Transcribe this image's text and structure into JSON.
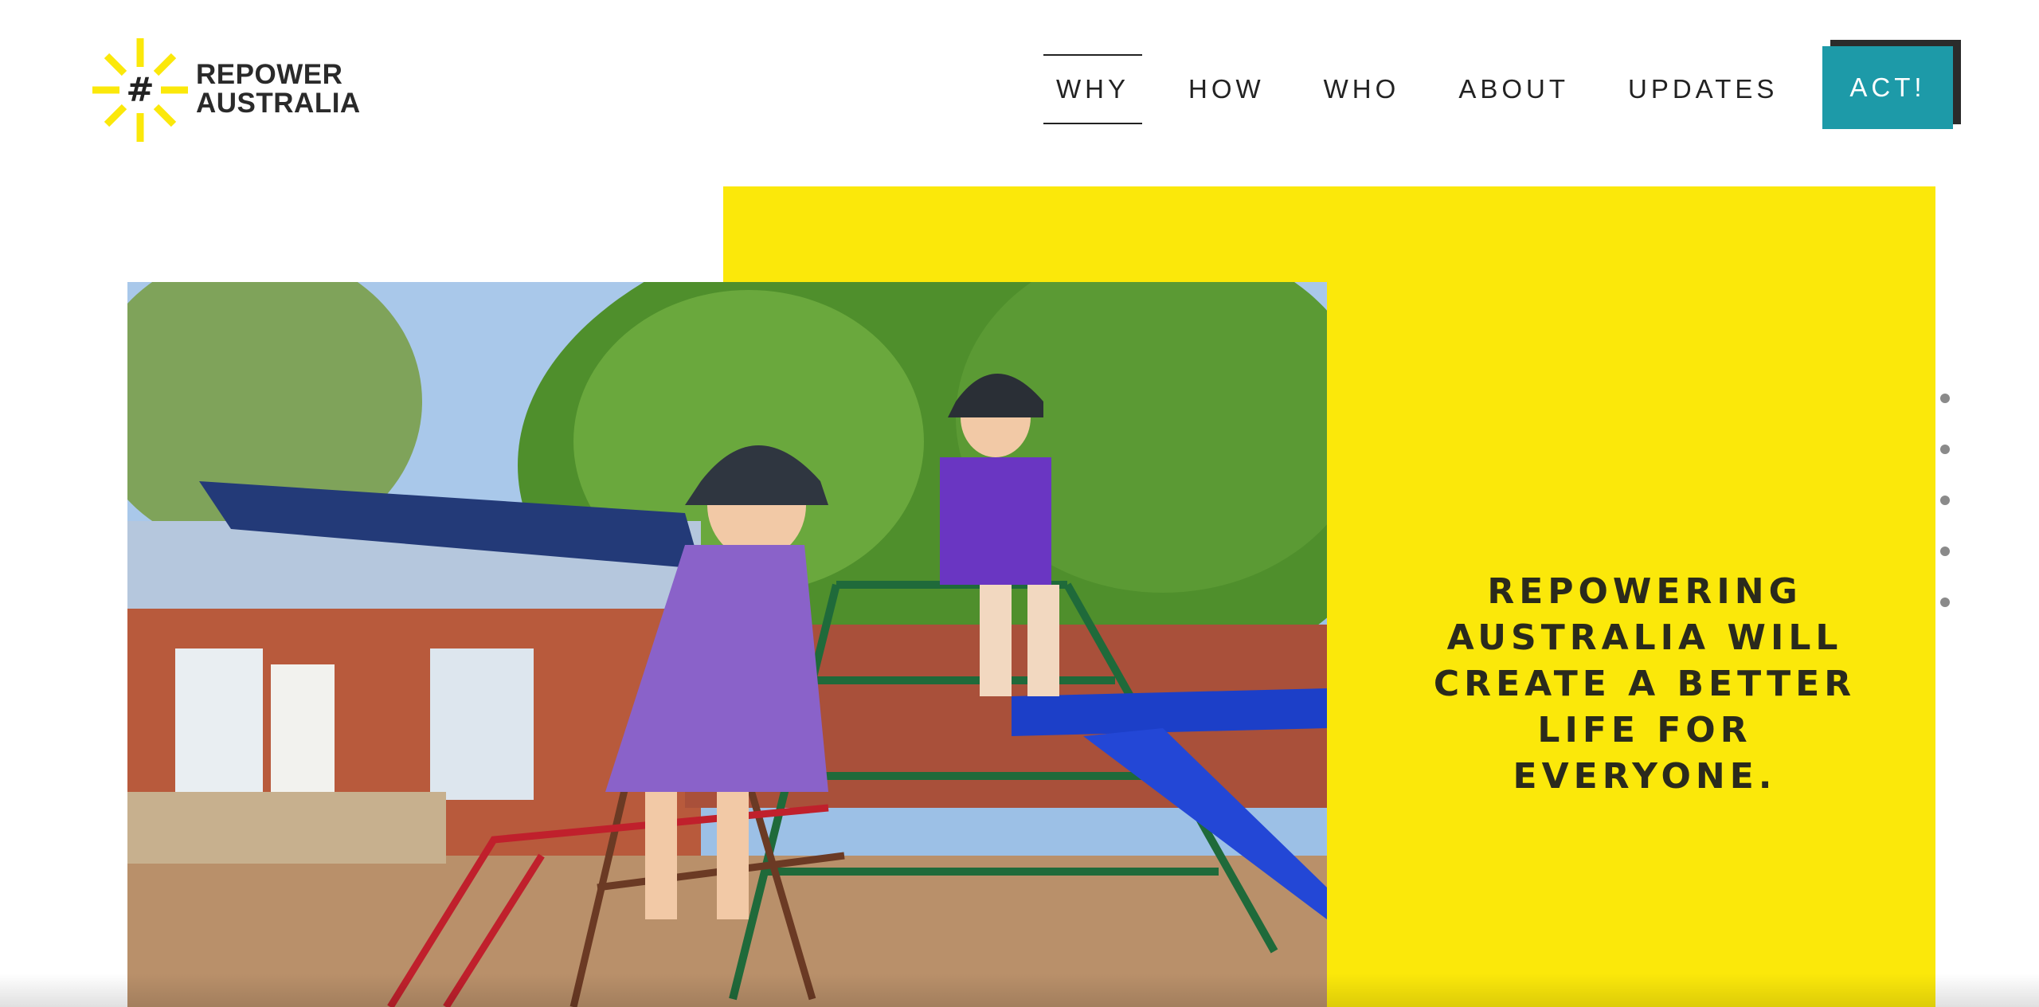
{
  "brand": {
    "line1": "REPOWER",
    "line2": "AUSTRALIA",
    "hash": "#",
    "sun_color": "#fbe80a"
  },
  "nav": {
    "items": [
      {
        "label": "WHY",
        "active": true
      },
      {
        "label": "HOW",
        "active": false
      },
      {
        "label": "WHO",
        "active": false
      },
      {
        "label": "ABOUT",
        "active": false
      },
      {
        "label": "UPDATES",
        "active": false
      }
    ],
    "cta_label": "ACT!",
    "cta_color": "#1d9aa8"
  },
  "hero": {
    "headline": "REPOWERING AUSTRALIA WILL CREATE A BETTER LIFE FOR EVERYONE.",
    "panel_color": "#fbe80a",
    "photo_icon": "playground-photo",
    "slide_count": 5
  }
}
